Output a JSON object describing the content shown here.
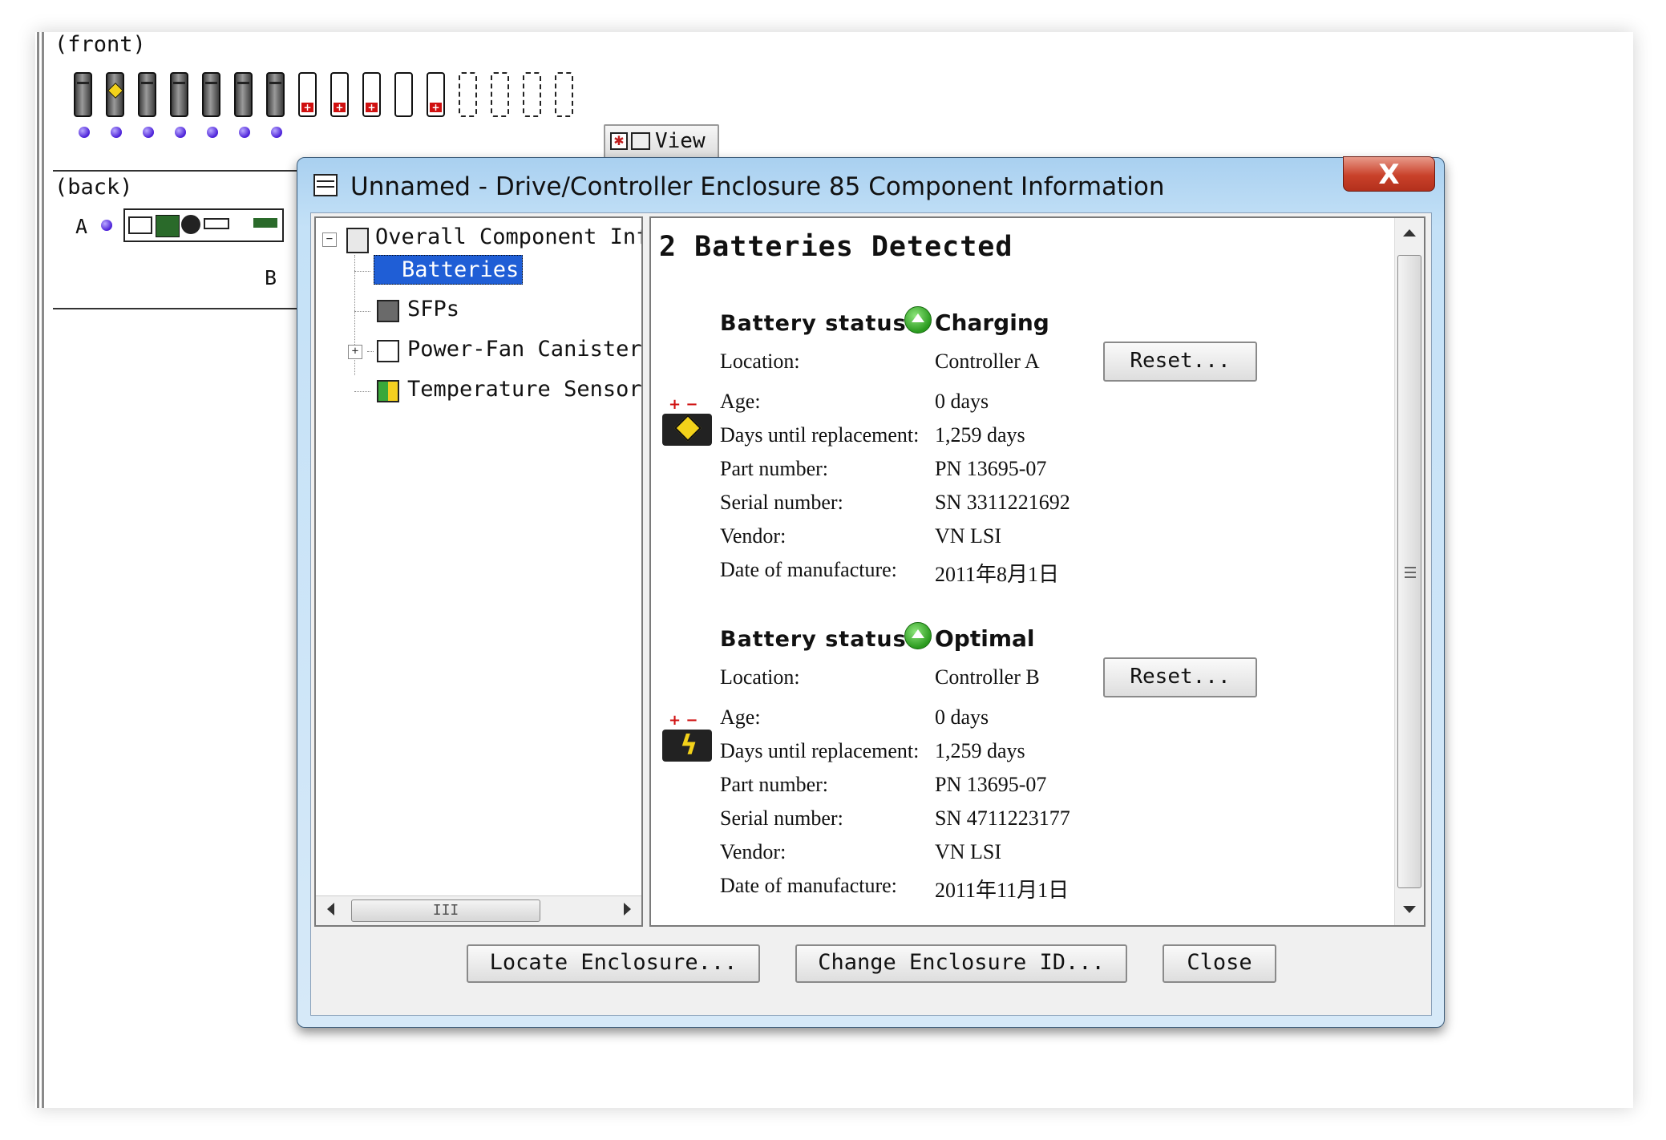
{
  "enclosure": {
    "front_label": "(front)",
    "back_label": "(back)",
    "controller_a_label": "A",
    "controller_b_label": "B",
    "view_button": "View"
  },
  "dialog": {
    "title": "Unnamed - Drive/Controller Enclosure 85 Component Information",
    "close_x": "X",
    "tree": {
      "root": "Overall Component Information",
      "items": [
        {
          "label": "Batteries",
          "icon": "battery-icon",
          "selected": true
        },
        {
          "label": "SFPs",
          "icon": "sfp-icon",
          "selected": false
        },
        {
          "label": "Power-Fan Canister",
          "icon": "power-fan-icon",
          "selected": false
        },
        {
          "label": "Temperature Sensors",
          "icon": "temperature-sensor-icon",
          "selected": false
        }
      ],
      "scroll_grip": "III"
    },
    "heading": "2 Batteries Detected",
    "status_label": "Battery status:",
    "reset_label": "Reset...",
    "field_labels": {
      "location": "Location:",
      "age": "Age:",
      "days_until_replacement": "Days until replacement:",
      "part_number": "Part number:",
      "serial_number": "Serial number:",
      "vendor": "Vendor:",
      "date_of_manufacture": "Date of manufacture:"
    },
    "batteries": [
      {
        "status": "Charging",
        "location": "Controller A",
        "age": "0 days",
        "days_until_replacement": "1,259 days",
        "part_number": "PN 13695-07",
        "serial_number": "SN 3311221692",
        "vendor": "VN LSI",
        "date_of_manufacture": "2011年8月1日"
      },
      {
        "status": "Optimal",
        "location": "Controller B",
        "age": "0 days",
        "days_until_replacement": "1,259 days",
        "part_number": "PN 13695-07",
        "serial_number": "SN 4711223177",
        "vendor": "VN LSI",
        "date_of_manufacture": "2011年11月1日"
      }
    ],
    "buttons": {
      "locate": "Locate Enclosure...",
      "change_id": "Change Enclosure ID...",
      "close": "Close"
    }
  },
  "colors": {
    "selection": "#1f5ed6",
    "title_bar": "#c4e1f7",
    "close_button": "#c9412a",
    "status_ok": "#2a9a1e",
    "led": "#4a1fd8"
  }
}
